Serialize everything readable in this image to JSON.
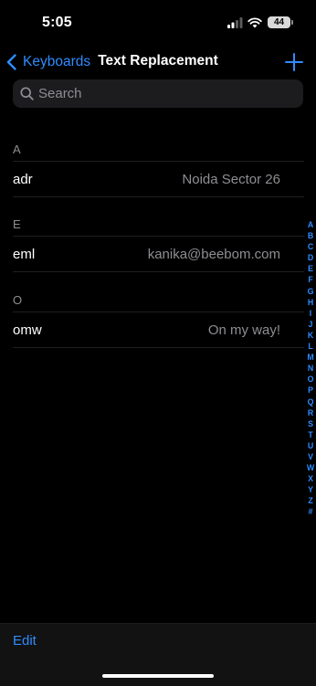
{
  "status": {
    "time": "5:05",
    "battery": "44"
  },
  "nav": {
    "back_label": "Keyboards",
    "title": "Text Replacement"
  },
  "search": {
    "placeholder": "Search"
  },
  "sections": [
    {
      "letter": "A",
      "shortcut": "adr",
      "phrase": "Noida Sector 26"
    },
    {
      "letter": "E",
      "shortcut": "eml",
      "phrase": "kanika@beebom.com"
    },
    {
      "letter": "O",
      "shortcut": "omw",
      "phrase": "On my way!"
    }
  ],
  "index_letters": [
    "A",
    "B",
    "C",
    "D",
    "E",
    "F",
    "G",
    "H",
    "I",
    "J",
    "K",
    "L",
    "M",
    "N",
    "O",
    "P",
    "Q",
    "R",
    "S",
    "T",
    "U",
    "V",
    "W",
    "X",
    "Y",
    "Z",
    "#"
  ],
  "toolbar": {
    "edit_label": "Edit"
  },
  "colors": {
    "accent": "#2f8cff",
    "background": "#000000",
    "secondary_text": "#8e8e93",
    "search_bg": "#1c1c1e"
  }
}
